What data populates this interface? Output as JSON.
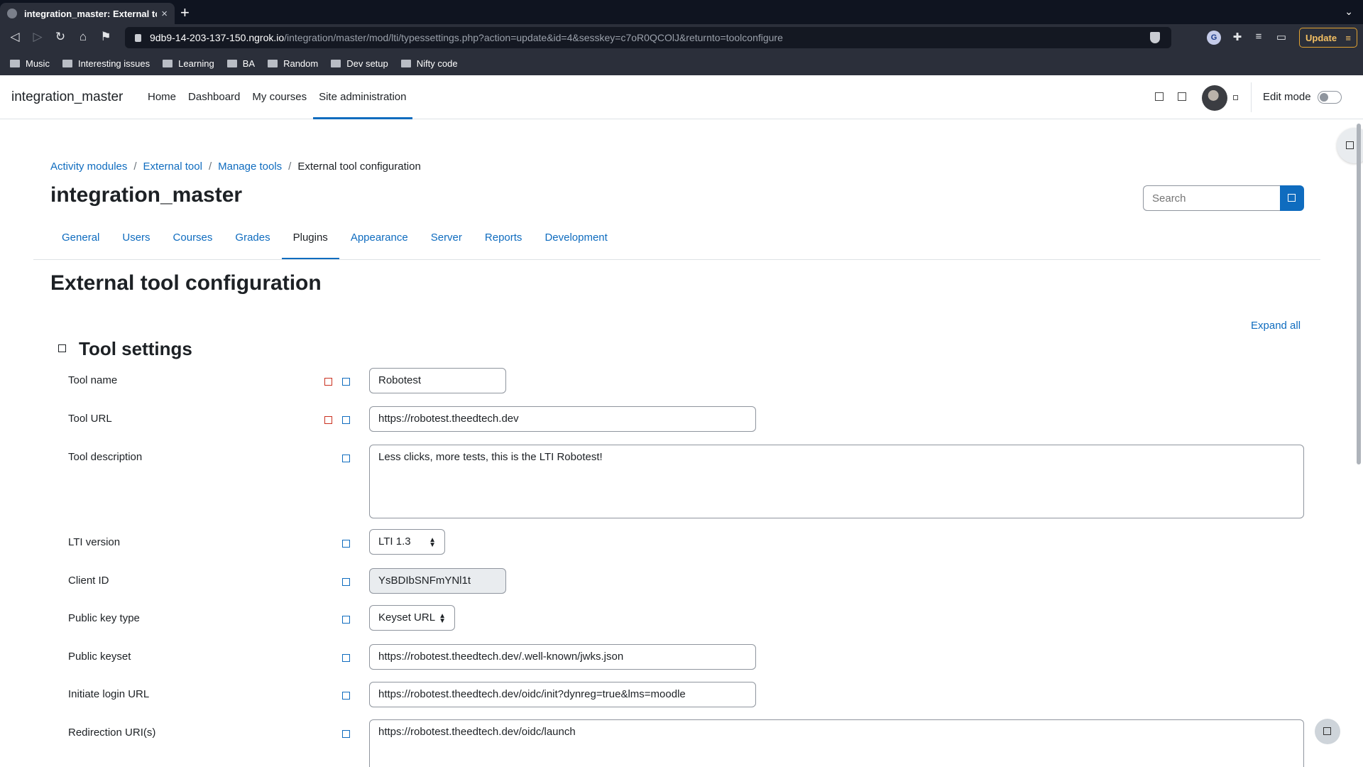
{
  "browser": {
    "tab_title": "integration_master: External tool",
    "tab_close": "×",
    "new_tab": "+",
    "url_host": "9db9-14-203-137-150.ngrok.io",
    "url_path": "/integration/master/mod/lti/typessettings.php?action=update&id=4&sesskey=c7oR0QCOlJ&returnto=toolconfigure",
    "update_label": "Update",
    "bookmarks": [
      "Music",
      "Interesting issues",
      "Learning",
      "BA",
      "Random",
      "Dev setup",
      "Nifty code"
    ]
  },
  "header": {
    "brand": "integration_master",
    "nav": [
      "Home",
      "Dashboard",
      "My courses",
      "Site administration"
    ],
    "active_nav": "Site administration",
    "edit_mode_label": "Edit mode",
    "edit_mode_on": false
  },
  "breadcrumb": {
    "items": [
      "Activity modules",
      "External tool",
      "Manage tools",
      "External tool configuration"
    ],
    "separator": "/"
  },
  "page": {
    "title": "integration_master",
    "search_placeholder": "Search",
    "tabs": [
      "General",
      "Users",
      "Courses",
      "Grades",
      "Plugins",
      "Appearance",
      "Server",
      "Reports",
      "Development"
    ],
    "active_tab": "Plugins",
    "heading": "External tool configuration",
    "expand_all": "Expand all",
    "section_title": "Tool settings"
  },
  "form": {
    "tool_name": {
      "label": "Tool name",
      "value": "Robotest"
    },
    "tool_url": {
      "label": "Tool URL",
      "value": "https://robotest.theedtech.dev"
    },
    "tool_description": {
      "label": "Tool description",
      "value": "Less clicks, more tests, this is the LTI Robotest!"
    },
    "lti_version": {
      "label": "LTI version",
      "value": "LTI 1.3"
    },
    "client_id": {
      "label": "Client ID",
      "value": "YsBDIbSNFmYNl1t"
    },
    "public_key_type": {
      "label": "Public key type",
      "value": "Keyset URL"
    },
    "public_keyset": {
      "label": "Public keyset",
      "value": "https://robotest.theedtech.dev/.well-known/jwks.json"
    },
    "initiate_login_url": {
      "label": "Initiate login URL",
      "value": "https://robotest.theedtech.dev/oidc/init?dynreg=true&lms=moodle"
    },
    "redirection_uris": {
      "label": "Redirection URI(s)",
      "value": "https://robotest.theedtech.dev/oidc/launch"
    }
  },
  "colors": {
    "primary": "#0f6cbf",
    "required": "#ca3120",
    "chrome_bg": "#2b2f3a",
    "update": "#e2a230"
  }
}
